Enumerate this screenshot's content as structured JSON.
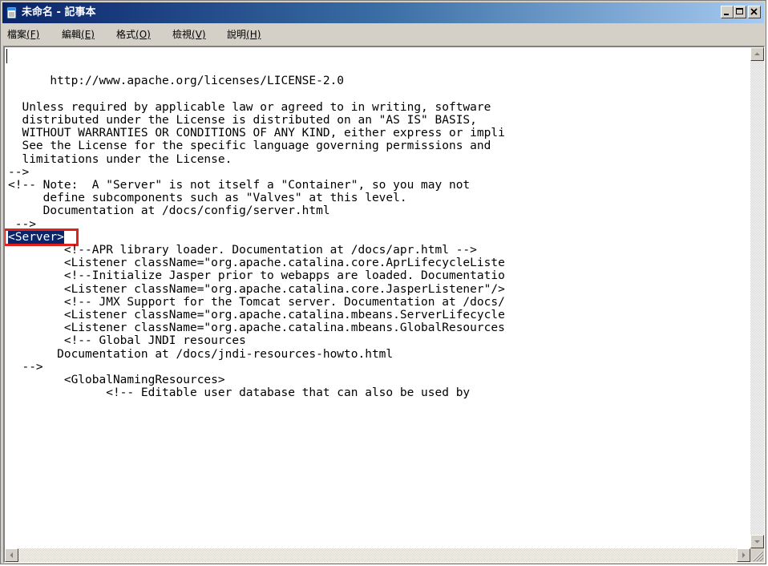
{
  "window": {
    "title": "未命名 - 記事本",
    "icon": "notepad-icon",
    "controls": [
      "minimize-icon",
      "maximize-icon",
      "close-icon"
    ]
  },
  "menu": [
    {
      "label": "檔案",
      "accel": "(F)"
    },
    {
      "label": "編輯",
      "accel": "(E)"
    },
    {
      "label": "格式",
      "accel": "(O)"
    },
    {
      "label": "檢視",
      "accel": "(V)"
    },
    {
      "label": "說明",
      "accel": "(H)"
    }
  ],
  "editor": {
    "lines": [
      "",
      "",
      "      http://www.apache.org/licenses/LICENSE-2.0",
      "",
      "  Unless required by applicable law or agreed to in writing, software",
      "  distributed under the License is distributed on an \"AS IS\" BASIS,",
      "  WITHOUT WARRANTIES OR CONDITIONS OF ANY KIND, either express or impli",
      "  See the License for the specific language governing permissions and",
      "  limitations under the License.",
      "-->",
      "<!-- Note:  A \"Server\" is not itself a \"Container\", so you may not",
      "     define subcomponents such as \"Valves\" at this level.",
      "     Documentation at /docs/config/server.html",
      " -->",
      "<Server>",
      "        <!--APR library loader. Documentation at /docs/apr.html -->",
      "        <Listener className=\"org.apache.catalina.core.AprLifecycleListe",
      "        <!--Initialize Jasper prior to webapps are loaded. Documentatio",
      "        <Listener className=\"org.apache.catalina.core.JasperListener\"/>",
      "        <!-- JMX Support for the Tomcat server. Documentation at /docs/",
      "        <Listener className=\"org.apache.catalina.mbeans.ServerLifecycle",
      "        <Listener className=\"org.apache.catalina.mbeans.GlobalResources",
      "        <!-- Global JNDI resources",
      "       Documentation at /docs/jndi-resources-howto.html",
      "  -->",
      "        <GlobalNamingResources>",
      "              <!-- Editable user database that can also be used by"
    ],
    "selected_text": "<Server>"
  },
  "colors": {
    "titlebar_start": "#0a246a",
    "titlebar_end": "#a6caf0",
    "selection": "#0a246a",
    "highlight_box": "#e0201a",
    "chrome": "#d4d0c8"
  }
}
